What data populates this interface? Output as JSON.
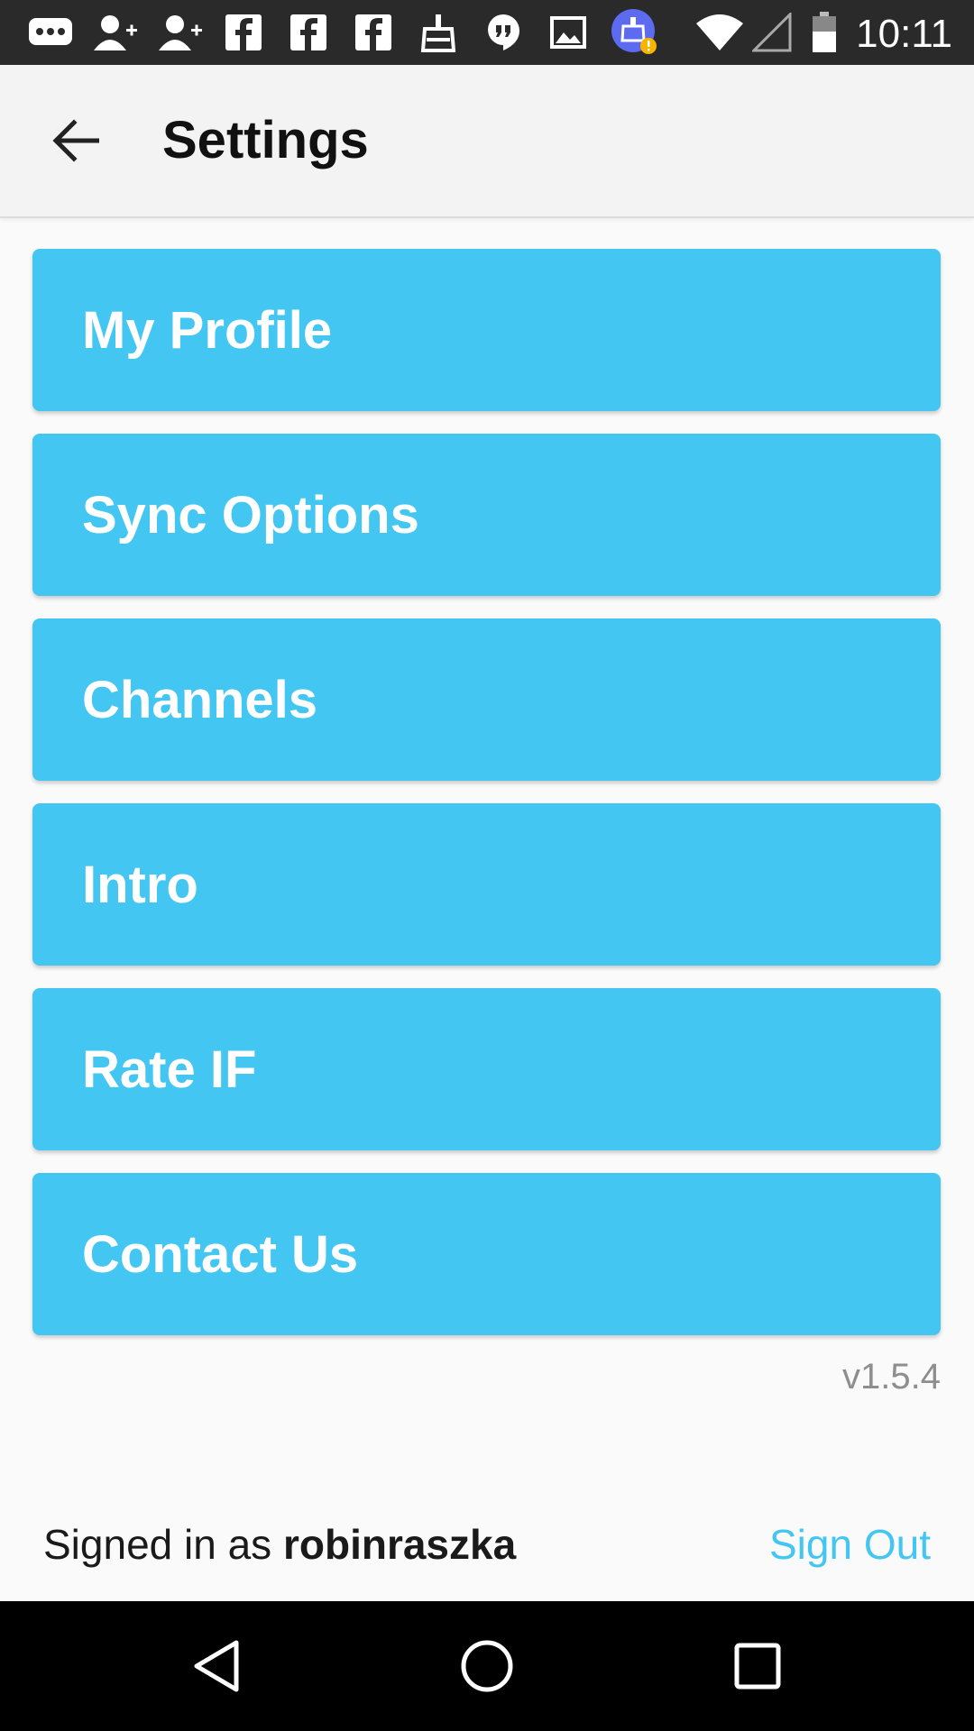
{
  "status_bar": {
    "time": "10:11",
    "icons": [
      "message-icon",
      "add-contact-icon",
      "add-contact-icon",
      "facebook-icon",
      "facebook-icon",
      "facebook-icon",
      "cleaner-icon",
      "hangouts-icon",
      "image-icon",
      "app-notification-icon",
      "wifi-icon",
      "signal-icon",
      "battery-icon"
    ]
  },
  "app_bar": {
    "title": "Settings",
    "back_icon": "arrow-back-icon"
  },
  "menu": {
    "items": [
      {
        "label": "My Profile"
      },
      {
        "label": "Sync Options"
      },
      {
        "label": "Channels"
      },
      {
        "label": "Intro"
      },
      {
        "label": "Rate IF"
      },
      {
        "label": "Contact Us"
      }
    ],
    "color": "#44c6f3"
  },
  "version": "v1.5.4",
  "footer": {
    "signed_in_prefix": "Signed in as ",
    "username": "robinraszka",
    "sign_out_label": "Sign Out"
  },
  "nav_bar": {
    "icons": [
      "back-triangle-icon",
      "home-circle-icon",
      "recents-square-icon"
    ]
  }
}
